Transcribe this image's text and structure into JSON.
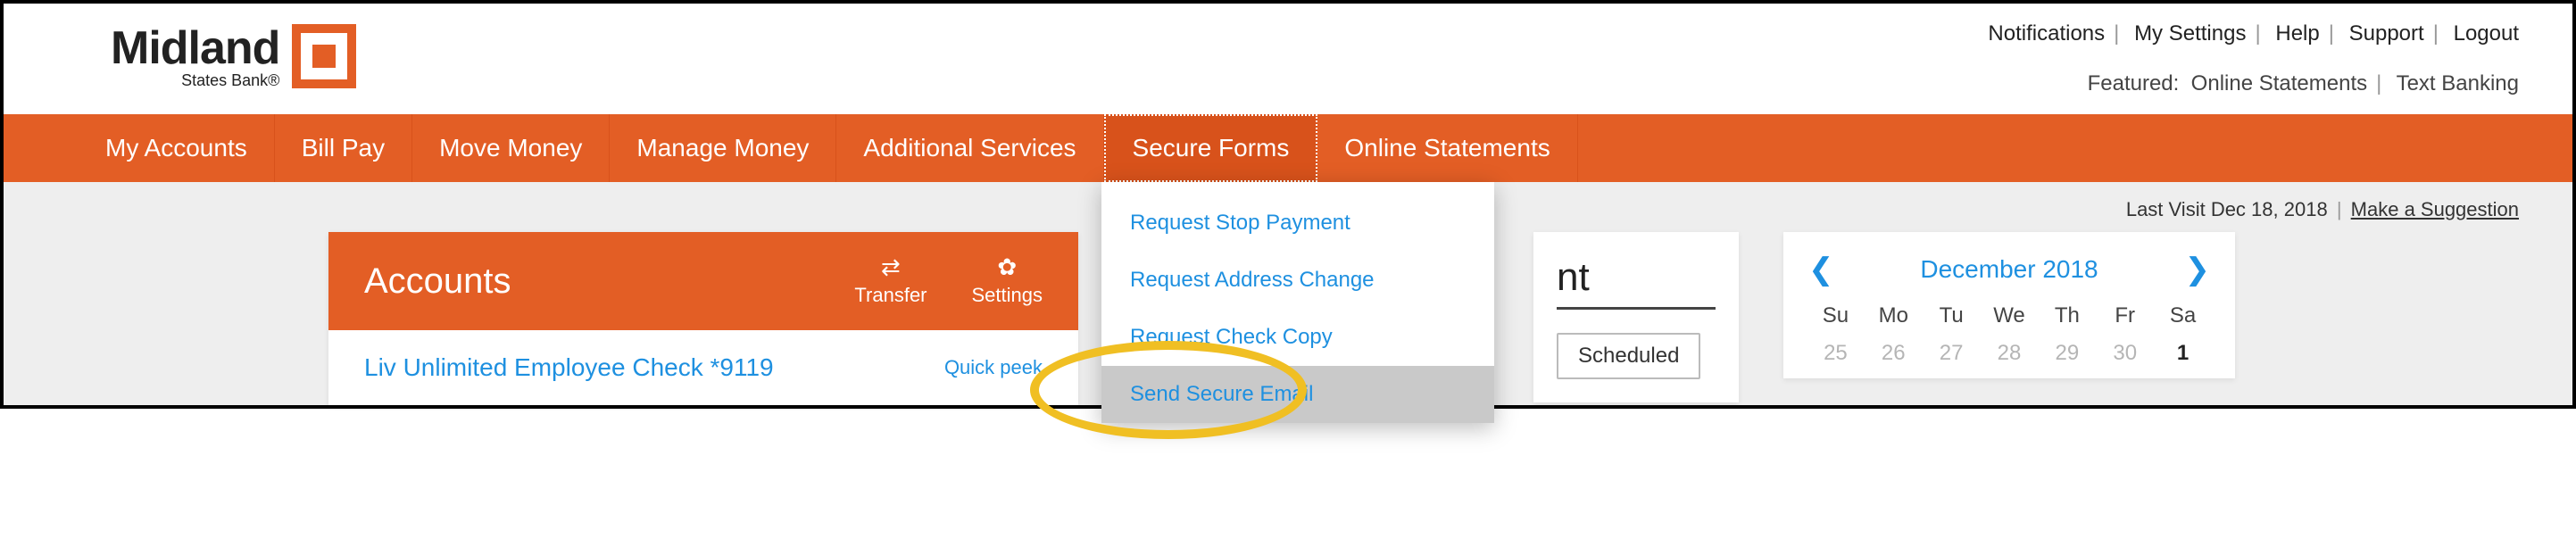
{
  "header": {
    "brand_main": "Midland",
    "brand_sub": "States Bank®",
    "top_links": [
      "Notifications",
      "My Settings",
      "Help",
      "Support",
      "Logout"
    ],
    "featured_label": "Featured:",
    "featured_links": [
      "Online Statements",
      "Text Banking"
    ]
  },
  "nav": {
    "items": [
      "My Accounts",
      "Bill Pay",
      "Move Money",
      "Manage Money",
      "Additional Services",
      "Secure Forms",
      "Online Statements"
    ],
    "active_index": 5,
    "dropdown": {
      "items": [
        "Request Stop Payment",
        "Request Address Change",
        "Request Check Copy",
        "Send Secure Email"
      ],
      "highlight_index": 3
    }
  },
  "status_bar": {
    "last_visit_label": "Last Visit",
    "last_visit_value": "Dec 18, 2018",
    "suggestion_link": "Make a Suggestion"
  },
  "accounts_card": {
    "title": "Accounts",
    "actions": {
      "transfer": "Transfer",
      "settings": "Settings"
    },
    "row1": {
      "name": "Liv Unlimited Employee Check  *9119",
      "quick_peek": "Quick peek"
    }
  },
  "peek_card": {
    "title_fragment": "nt",
    "tab_label": "Scheduled"
  },
  "calendar": {
    "month_label": "December 2018",
    "dow": [
      "Su",
      "Mo",
      "Tu",
      "We",
      "Th",
      "Fr",
      "Sa"
    ],
    "days": [
      "25",
      "26",
      "27",
      "28",
      "29",
      "30",
      "1"
    ],
    "current_index": 6
  }
}
